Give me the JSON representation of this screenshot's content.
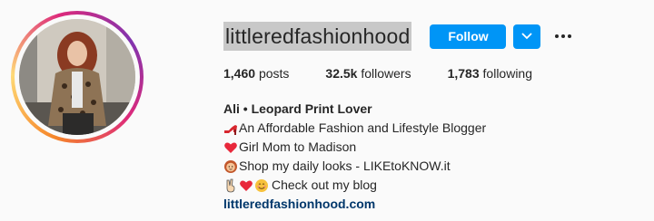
{
  "profile": {
    "username": "littleredfashionhood",
    "follow_label": "Follow",
    "posts_count": "1,460",
    "posts_label": "posts",
    "followers_count": "32.5k",
    "followers_label": "followers",
    "following_count": "1,783",
    "following_label": "following",
    "full_name": "Ali • Leopard Print Lover",
    "bio_lines": [
      {
        "text": "An Affordable Fashion and Lifestyle Blogger",
        "icons": [
          "high-heel-icon"
        ]
      },
      {
        "text": " Girl Mom to Madison",
        "icons": [
          "heart-icon"
        ]
      },
      {
        "text": "Shop my daily looks - LIKEtoKNOW.it",
        "icons": [
          "woman-tipping-hand-icon"
        ]
      },
      {
        "text": "Check out my blog",
        "icons": [
          "victory-hand-icon",
          "heart-icon",
          "smiling-face-icon"
        ]
      }
    ],
    "website": "littleredfashionhood.com"
  },
  "colors": {
    "accent": "#0095f6",
    "link": "#00376b",
    "text": "#262626",
    "background": "#fafafa"
  }
}
